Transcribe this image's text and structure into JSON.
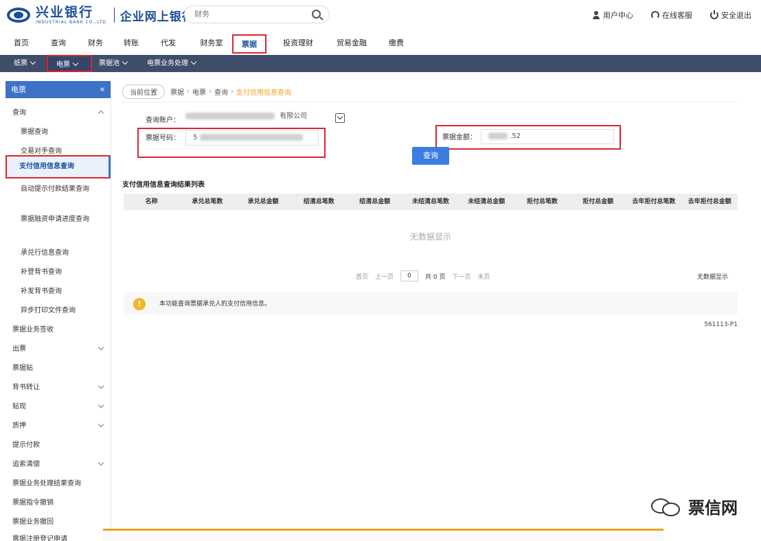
{
  "header": {
    "logo_cn": "兴业银行",
    "logo_en": "INDUSTRIAL BANK CO.,LTD.",
    "logo_sub": "企业网上银行",
    "search_placeholder": "财务",
    "links": [
      {
        "label": "用户中心",
        "icon": "user-icon"
      },
      {
        "label": "在线客服",
        "icon": "service-icon"
      },
      {
        "label": "安全退出",
        "icon": "power-icon"
      }
    ]
  },
  "mainnav": {
    "items": [
      "首页",
      "查询",
      "财务",
      "转账",
      "代发",
      "财务室",
      "票据",
      "投资理财",
      "贸易金融",
      "缴费"
    ],
    "active_index": 6
  },
  "subnav": {
    "items": [
      "纸票",
      "电票",
      "票据池",
      "电票业务处理"
    ],
    "active_index": 1
  },
  "sidebar": {
    "title": "电票",
    "rows": [
      {
        "label": "查询",
        "type": "group",
        "expanded": true
      },
      {
        "label": "票据查询",
        "type": "child"
      },
      {
        "label": "交易对手查询",
        "type": "child"
      },
      {
        "label": "支付信用信息查询",
        "type": "child",
        "active": true
      },
      {
        "label": "自动提示付款结果查询",
        "type": "child"
      },
      {
        "label": "票据融资申请进度查询",
        "type": "child"
      },
      {
        "label": "承兑行信息查询",
        "type": "child"
      },
      {
        "label": "补登背书查询",
        "type": "child"
      },
      {
        "label": "补发背书查询",
        "type": "child"
      },
      {
        "label": "异步打印文件查询",
        "type": "child"
      },
      {
        "label": "票据业务签收",
        "type": "group"
      },
      {
        "label": "出票",
        "type": "group",
        "chevron": true
      },
      {
        "label": "票据贴",
        "type": "group"
      },
      {
        "label": "背书转让",
        "type": "group",
        "chevron": true
      },
      {
        "label": "贴现",
        "type": "group",
        "chevron": true
      },
      {
        "label": "质押",
        "type": "group",
        "chevron": true
      },
      {
        "label": "提示付款",
        "type": "group"
      },
      {
        "label": "追索清偿",
        "type": "group",
        "chevron": true
      },
      {
        "label": "票据业务处理结果查询",
        "type": "group"
      },
      {
        "label": "票据指令撤销",
        "type": "group"
      },
      {
        "label": "票据业务撤回",
        "type": "group"
      },
      {
        "label": "票据注册登记申请",
        "type": "group"
      }
    ]
  },
  "breadcrumb": {
    "tag": "当前位置",
    "items": [
      "票据",
      "电票",
      "查询"
    ],
    "current": "支付信用信息查询"
  },
  "form": {
    "account_label": "查询账户：",
    "account_suffix": "有限公司",
    "bill_no_label": "票据号码：",
    "bill_no_value": "5",
    "amount_label": "票据金额：",
    "amount_value": ".52",
    "query_button": "查询"
  },
  "table": {
    "title": "支付信用信息查询结果列表",
    "columns": [
      "名称",
      "承兑总笔数",
      "承兑总金额",
      "结清总笔数",
      "结清总金额",
      "未结清总笔数",
      "未结清总金额",
      "拒付总笔数",
      "拒付总金额",
      "去年拒付总笔数",
      "去年拒付总金额"
    ],
    "empty_text": "无数据显示"
  },
  "pager": {
    "first": "首页",
    "prev": "上一页",
    "page": "0",
    "total": "共 0 页",
    "next": "下一页",
    "last": "末页",
    "right_text": "无数据显示"
  },
  "tip": {
    "icon": "!",
    "text": "本功能查询票据承兑人的支付信用信息。"
  },
  "page_code": "561113-P1",
  "watermark": "票信网",
  "colors": {
    "brand": "#1b4f9a",
    "highlight": "#d7262e",
    "subnav_bg": "#3e4d6a",
    "button": "#3b7de0",
    "breadcrumb_current": "#f0a020"
  }
}
